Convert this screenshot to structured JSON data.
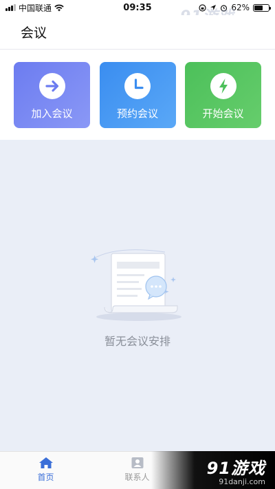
{
  "status_bar": {
    "carrier": "中国联通",
    "time": "09:35",
    "battery": "62%",
    "battery_level": 0.62
  },
  "watermark": {
    "logo": "91游戏",
    "sub": "91danji.com"
  },
  "header": {
    "title": "会议"
  },
  "actions": [
    {
      "label": "加入会议",
      "icon": "arrow-right-icon"
    },
    {
      "label": "预约会议",
      "icon": "clock-icon"
    },
    {
      "label": "开始会议",
      "icon": "lightning-icon"
    }
  ],
  "empty": {
    "text": "暂无会议安排"
  },
  "bottom_nav": {
    "items": [
      {
        "label": "首页",
        "icon": "home-icon"
      },
      {
        "label": "联系人",
        "icon": "contact-icon"
      }
    ]
  },
  "bottom_watermark": {
    "logo": "91游戏",
    "sub": "91danji.com"
  },
  "colors": {
    "join": "#6c7cf0",
    "schedule": "#3a8df0",
    "start": "#4cc05a",
    "nav_active": "#3b6fd8",
    "empty_bg": "#eaeef7"
  }
}
